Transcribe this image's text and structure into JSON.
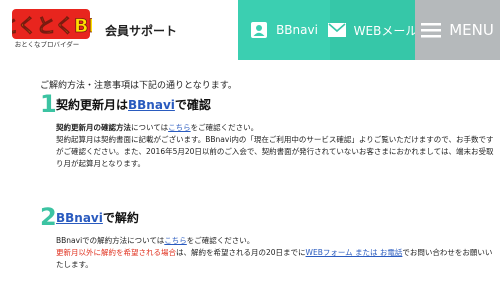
{
  "header": {
    "logo_text": "とくとくBB",
    "logo_sub": "おとくなプロバイダー",
    "title": "会員サポート",
    "nav": {
      "bbnavi": "BBnavi",
      "webmail": "WEBメール",
      "menu": "MENU"
    }
  },
  "main": {
    "intro": "ご解約方法・注意事項は下記の通りとなります。",
    "step1": {
      "number": "1",
      "heading_pre": "契約更新月は",
      "heading_link": "BBnavi",
      "heading_post": "で確認",
      "line1_pre": "契約更新月の確認方法",
      "line1_mid": "については",
      "line1_link": "こちら",
      "line1_post": "をご確認ください。",
      "line2": "契約起算月は契約書面に記載がございます。BBnavi内の「現在ご利用中のサービス確認」よりご覧いただけますので、お手数です",
      "line3": "がご確認ください。また、2016年5月20日以前のご入会で、契約書面が発行されていないお客さまにおかれましては、端末お受取",
      "line4": "り月が起算月となります。"
    },
    "step2": {
      "number": "2",
      "heading_link": "BBnavi",
      "heading_post": "で解約",
      "line1_pre": "BBnaviでの解約方法",
      "line1_mid": "については",
      "line1_link": "こちら",
      "line1_post": "をご確認ください。",
      "line2_red": "更新月以外に解約を希望される場合",
      "line2_mid": "は、解約を希望される月の20日までに",
      "line2_link": "WEBフォーム または お電話",
      "line2_post": "でお問い合わせをお願いい",
      "line3": "たします。"
    }
  },
  "colors": {
    "accent": "#3bcfb1",
    "menu_gray": "#b5b9bb",
    "link": "#2a5bbf",
    "warning": "#e0301e",
    "logo_red": "#e8251e",
    "logo_yellow": "#ffe000"
  }
}
